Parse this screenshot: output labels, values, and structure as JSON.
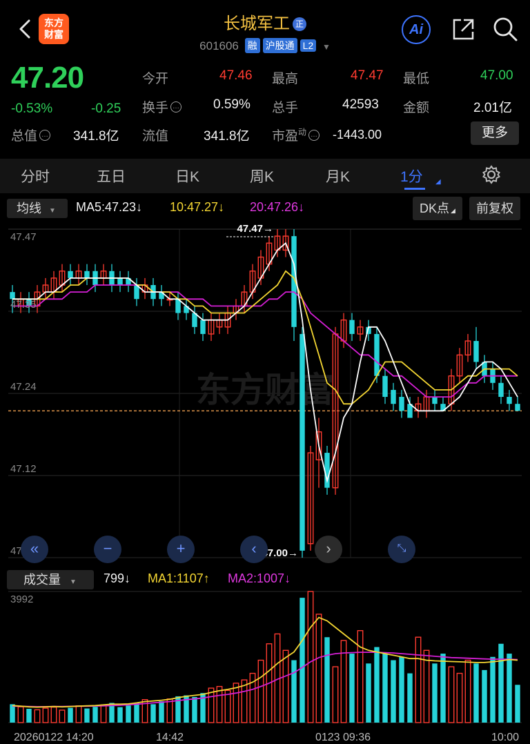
{
  "header": {
    "logo_line1": "东方",
    "logo_line2": "财富",
    "stock_name": "长城军工",
    "zheng_badge": "正",
    "code": "601606",
    "tags": [
      "融",
      "沪股通",
      "L2"
    ],
    "ai_label": "Ai"
  },
  "quote": {
    "price": "47.20",
    "change_pct": "-0.53%",
    "change": "-0.25",
    "total_value_label": "总值",
    "total_value": "341.8亿",
    "open_label": "今开",
    "open": "47.46",
    "high_label": "最高",
    "high": "47.47",
    "low_label": "最低",
    "low": "47.00",
    "turnover_label": "换手",
    "turnover": "0.59%",
    "volume_label": "总手",
    "volume": "42593",
    "amount_label": "金额",
    "amount": "2.01亿",
    "float_label": "流值",
    "float_value": "341.8亿",
    "pe_label": "市盈",
    "pe_sup": "动",
    "pe": "-1443.00",
    "more_label": "更多"
  },
  "tabs": [
    "分时",
    "五日",
    "日K",
    "周K",
    "月K",
    "1分"
  ],
  "active_tab": "1分",
  "toolbar": {
    "indicator": "均线",
    "ma5": "MA5:47.23",
    "ma10": "10:47.27",
    "ma20": "20:47.26",
    "dk_label": "DK点",
    "adjust_label": "前复权"
  },
  "volume_toolbar": {
    "indicator": "成交量",
    "vol": "799",
    "ma1": "MA1:1107",
    "ma2": "MA2:1007"
  },
  "watermark": "东方财富",
  "colors": {
    "up": "#ff3b30",
    "down": "#2fd05a",
    "candle_down": "#27d3d8",
    "ma5": "#ffffff",
    "ma10": "#f5d733",
    "ma20": "#d61fd6",
    "accent": "#3e74ff"
  },
  "chart_data": {
    "type": "candlestick",
    "price_axis_ticks": [
      "47.47",
      "47.35",
      "47.24",
      "47.12",
      "47.00"
    ],
    "price_range": [
      47.0,
      47.47
    ],
    "high_marker": "47.47",
    "low_marker": "47.00",
    "reference_price": 47.21,
    "volume_axis_max": "3992",
    "volume_range": [
      0,
      3992
    ],
    "x_labels": [
      "20260122 14:20",
      "14:42",
      "0123 09:36",
      "10:00"
    ],
    "candles": [
      {
        "o": 47.38,
        "c": 47.37,
        "h": 47.39,
        "l": 47.35
      },
      {
        "o": 47.36,
        "c": 47.37,
        "h": 47.38,
        "l": 47.35
      },
      {
        "o": 47.37,
        "c": 47.36,
        "h": 47.38,
        "l": 47.35
      },
      {
        "o": 47.36,
        "c": 47.38,
        "h": 47.39,
        "l": 47.35
      },
      {
        "o": 47.38,
        "c": 47.39,
        "h": 47.4,
        "l": 47.37
      },
      {
        "o": 47.38,
        "c": 47.4,
        "h": 47.41,
        "l": 47.37
      },
      {
        "o": 47.39,
        "c": 47.41,
        "h": 47.42,
        "l": 47.38
      },
      {
        "o": 47.41,
        "c": 47.4,
        "h": 47.42,
        "l": 47.39
      },
      {
        "o": 47.4,
        "c": 47.41,
        "h": 47.42,
        "l": 47.39
      },
      {
        "o": 47.41,
        "c": 47.4,
        "h": 47.42,
        "l": 47.39
      },
      {
        "o": 47.41,
        "c": 47.39,
        "h": 47.42,
        "l": 47.38
      },
      {
        "o": 47.4,
        "c": 47.41,
        "h": 47.42,
        "l": 47.39
      },
      {
        "o": 47.41,
        "c": 47.39,
        "h": 47.42,
        "l": 47.38
      },
      {
        "o": 47.4,
        "c": 47.39,
        "h": 47.41,
        "l": 47.38
      },
      {
        "o": 47.4,
        "c": 47.39,
        "h": 47.41,
        "l": 47.38
      },
      {
        "o": 47.39,
        "c": 47.37,
        "h": 47.4,
        "l": 47.36
      },
      {
        "o": 47.38,
        "c": 47.39,
        "h": 47.4,
        "l": 47.37
      },
      {
        "o": 47.39,
        "c": 47.37,
        "h": 47.4,
        "l": 47.36
      },
      {
        "o": 47.38,
        "c": 47.37,
        "h": 47.39,
        "l": 47.36
      },
      {
        "o": 47.37,
        "c": 47.37,
        "h": 47.38,
        "l": 47.36
      },
      {
        "o": 47.37,
        "c": 47.35,
        "h": 47.38,
        "l": 47.34
      },
      {
        "o": 47.36,
        "c": 47.35,
        "h": 47.37,
        "l": 47.34
      },
      {
        "o": 47.35,
        "c": 47.33,
        "h": 47.36,
        "l": 47.32
      },
      {
        "o": 47.34,
        "c": 47.32,
        "h": 47.35,
        "l": 47.31
      },
      {
        "o": 47.32,
        "c": 47.34,
        "h": 47.35,
        "l": 47.31
      },
      {
        "o": 47.33,
        "c": 47.34,
        "h": 47.35,
        "l": 47.32
      },
      {
        "o": 47.33,
        "c": 47.35,
        "h": 47.36,
        "l": 47.32
      },
      {
        "o": 47.35,
        "c": 47.36,
        "h": 47.37,
        "l": 47.34
      },
      {
        "o": 47.36,
        "c": 47.38,
        "h": 47.39,
        "l": 47.35
      },
      {
        "o": 47.38,
        "c": 47.41,
        "h": 47.42,
        "l": 47.37
      },
      {
        "o": 47.4,
        "c": 47.43,
        "h": 47.44,
        "l": 47.39
      },
      {
        "o": 47.42,
        "c": 47.45,
        "h": 47.46,
        "l": 47.41
      },
      {
        "o": 47.44,
        "c": 47.46,
        "h": 47.47,
        "l": 47.43
      },
      {
        "o": 47.44,
        "c": 47.46,
        "h": 47.47,
        "l": 47.43
      },
      {
        "o": 47.46,
        "c": 47.33,
        "h": 47.47,
        "l": 47.31
      },
      {
        "o": 47.32,
        "c": 47.01,
        "h": 47.33,
        "l": 47.0
      },
      {
        "o": 47.02,
        "c": 47.15,
        "h": 47.16,
        "l": 47.01
      },
      {
        "o": 47.14,
        "c": 47.18,
        "h": 47.2,
        "l": 47.1
      },
      {
        "o": 47.15,
        "c": 47.1,
        "h": 47.16,
        "l": 47.09
      },
      {
        "o": 47.1,
        "c": 47.32,
        "h": 47.33,
        "l": 47.09
      },
      {
        "o": 47.31,
        "c": 47.34,
        "h": 47.35,
        "l": 47.3
      },
      {
        "o": 47.34,
        "c": 47.32,
        "h": 47.35,
        "l": 47.31
      },
      {
        "o": 47.32,
        "c": 47.33,
        "h": 47.34,
        "l": 47.31
      },
      {
        "o": 47.33,
        "c": 47.32,
        "h": 47.34,
        "l": 47.31
      },
      {
        "o": 47.32,
        "c": 47.26,
        "h": 47.33,
        "l": 47.25
      },
      {
        "o": 47.26,
        "c": 47.23,
        "h": 47.27,
        "l": 47.22
      },
      {
        "o": 47.24,
        "c": 47.22,
        "h": 47.25,
        "l": 47.21
      },
      {
        "o": 47.23,
        "c": 47.21,
        "h": 47.24,
        "l": 47.2
      },
      {
        "o": 47.22,
        "c": 47.2,
        "h": 47.23,
        "l": 47.2
      },
      {
        "o": 47.21,
        "c": 47.22,
        "h": 47.23,
        "l": 47.2
      },
      {
        "o": 47.21,
        "c": 47.23,
        "h": 47.24,
        "l": 47.2
      },
      {
        "o": 47.23,
        "c": 47.22,
        "h": 47.24,
        "l": 47.21
      },
      {
        "o": 47.22,
        "c": 47.21,
        "h": 47.23,
        "l": 47.21
      },
      {
        "o": 47.22,
        "c": 47.26,
        "h": 47.27,
        "l": 47.21
      },
      {
        "o": 47.26,
        "c": 47.29,
        "h": 47.3,
        "l": 47.25
      },
      {
        "o": 47.29,
        "c": 47.31,
        "h": 47.32,
        "l": 47.28
      },
      {
        "o": 47.31,
        "c": 47.28,
        "h": 47.33,
        "l": 47.27
      },
      {
        "o": 47.28,
        "c": 47.26,
        "h": 47.29,
        "l": 47.25
      },
      {
        "o": 47.27,
        "c": 47.25,
        "h": 47.28,
        "l": 47.24
      },
      {
        "o": 47.25,
        "c": 47.23,
        "h": 47.26,
        "l": 47.22
      },
      {
        "o": 47.23,
        "c": 47.22,
        "h": 47.24,
        "l": 47.21
      },
      {
        "o": 47.22,
        "c": 47.21,
        "h": 47.23,
        "l": 47.21
      }
    ],
    "ma5": [
      47.37,
      47.37,
      47.37,
      47.37,
      47.38,
      47.38,
      47.39,
      47.4,
      47.4,
      47.4,
      47.4,
      47.4,
      47.4,
      47.4,
      47.4,
      47.39,
      47.38,
      47.38,
      47.38,
      47.37,
      47.37,
      47.36,
      47.35,
      47.34,
      47.34,
      47.34,
      47.34,
      47.35,
      47.36,
      47.38,
      47.4,
      47.42,
      47.44,
      47.45,
      47.42,
      47.34,
      47.24,
      47.16,
      47.11,
      47.15,
      47.2,
      47.22,
      47.28,
      47.33,
      47.33,
      47.31,
      47.28,
      47.25,
      47.22,
      47.21,
      47.21,
      47.21,
      47.21,
      47.22,
      47.23,
      47.25,
      47.27,
      47.28,
      47.28,
      47.27,
      47.25,
      47.23
    ],
    "ma10": [
      47.37,
      47.37,
      47.37,
      47.37,
      47.37,
      47.38,
      47.38,
      47.39,
      47.39,
      47.4,
      47.4,
      47.4,
      47.4,
      47.4,
      47.4,
      47.39,
      47.39,
      47.38,
      47.38,
      47.38,
      47.37,
      47.37,
      47.36,
      47.36,
      47.35,
      47.35,
      47.35,
      47.35,
      47.35,
      47.36,
      47.37,
      47.38,
      47.39,
      47.41,
      47.4,
      47.37,
      47.33,
      47.29,
      47.25,
      47.24,
      47.22,
      47.22,
      47.23,
      47.24,
      47.26,
      47.28,
      47.28,
      47.28,
      47.27,
      47.26,
      47.25,
      47.24,
      47.24,
      47.24,
      47.25,
      47.26,
      47.26,
      47.27,
      47.27,
      47.27,
      47.27,
      47.26
    ],
    "ma20": [
      47.36,
      47.36,
      47.36,
      47.36,
      47.37,
      47.37,
      47.37,
      47.38,
      47.38,
      47.38,
      47.39,
      47.39,
      47.39,
      47.39,
      47.39,
      47.39,
      47.39,
      47.38,
      47.38,
      47.38,
      47.38,
      47.37,
      47.37,
      47.37,
      47.36,
      47.36,
      47.36,
      47.36,
      47.36,
      47.36,
      47.36,
      47.37,
      47.37,
      47.38,
      47.38,
      47.37,
      47.35,
      47.34,
      47.33,
      47.32,
      47.31,
      47.3,
      47.29,
      47.29,
      47.28,
      47.27,
      47.26,
      47.26,
      47.25,
      47.24,
      47.23,
      47.23,
      47.23,
      47.23,
      47.24,
      47.25,
      47.25,
      47.26,
      47.26,
      47.26,
      47.26,
      47.26
    ],
    "volume": [
      560,
      480,
      420,
      390,
      440,
      470,
      380,
      450,
      510,
      430,
      480,
      540,
      600,
      470,
      520,
      610,
      700,
      560,
      650,
      720,
      800,
      830,
      780,
      900,
      1050,
      1100,
      980,
      1200,
      1300,
      1500,
      1900,
      2400,
      2700,
      2200,
      1900,
      3800,
      3992,
      3300,
      2600,
      1700,
      2500,
      2100,
      2800,
      1800,
      2300,
      2100,
      1900,
      2000,
      1500,
      2600,
      2200,
      1800,
      2100,
      1700,
      1500,
      1900,
      1800,
      1600,
      2000,
      2400,
      2100,
      1150
    ],
    "vol_ma1": [
      520,
      500,
      480,
      470,
      480,
      490,
      480,
      490,
      500,
      510,
      520,
      540,
      560,
      560,
      570,
      600,
      640,
      660,
      680,
      710,
      760,
      800,
      830,
      860,
      920,
      970,
      1010,
      1060,
      1130,
      1230,
      1380,
      1580,
      1800,
      1980,
      2150,
      2500,
      2900,
      3200,
      3100,
      2900,
      2700,
      2500,
      2300,
      2200,
      2150,
      2100,
      2050,
      2000,
      1950,
      1950,
      1900,
      1880,
      1870,
      1860,
      1850,
      1840,
      1830,
      1830,
      1850,
      1880,
      1920,
      1900
    ],
    "vol_ma2": [
      500,
      495,
      490,
      485,
      485,
      490,
      490,
      495,
      500,
      500,
      505,
      510,
      520,
      530,
      540,
      560,
      580,
      600,
      620,
      640,
      670,
      700,
      720,
      750,
      790,
      830,
      860,
      900,
      950,
      1010,
      1100,
      1200,
      1320,
      1420,
      1520,
      1680,
      1850,
      1980,
      2050,
      2100,
      2120,
      2130,
      2140,
      2140,
      2140,
      2130,
      2120,
      2100,
      2080,
      2060,
      2040,
      2020,
      2000,
      1980,
      1970,
      1960,
      1950,
      1940,
      1930,
      1930,
      1930,
      1920
    ]
  }
}
